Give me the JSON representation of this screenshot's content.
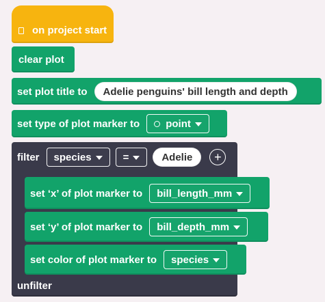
{
  "blocks": {
    "hat": {
      "label": "on project start",
      "icon": "flag-icon"
    },
    "clear_plot": {
      "label": "clear plot"
    },
    "set_title": {
      "label": "set plot title to",
      "value": "Adelie penguins' bill length and depth"
    },
    "set_type": {
      "label": "set type of plot marker to",
      "value": "point",
      "icon": "circle-marker-icon"
    },
    "filter": {
      "label": "filter",
      "field": "species",
      "operator": "=",
      "value": "Adelie",
      "add_icon": "plus-circle-icon",
      "end_label": "unfilter"
    },
    "set_x": {
      "label": "set ‘x’ of plot marker to",
      "value": "bill_length_mm"
    },
    "set_y": {
      "label": "set ‘y’ of plot marker to",
      "value": "bill_depth_mm"
    },
    "set_color": {
      "label": "set color of plot marker to",
      "value": "species"
    }
  },
  "colors": {
    "background": "#f6f0f3",
    "hat": "#f7b40f",
    "green": "#12a36a",
    "filter_container": "#3a3a4a",
    "text_light": "#ffffff",
    "text_dark": "#333333"
  }
}
